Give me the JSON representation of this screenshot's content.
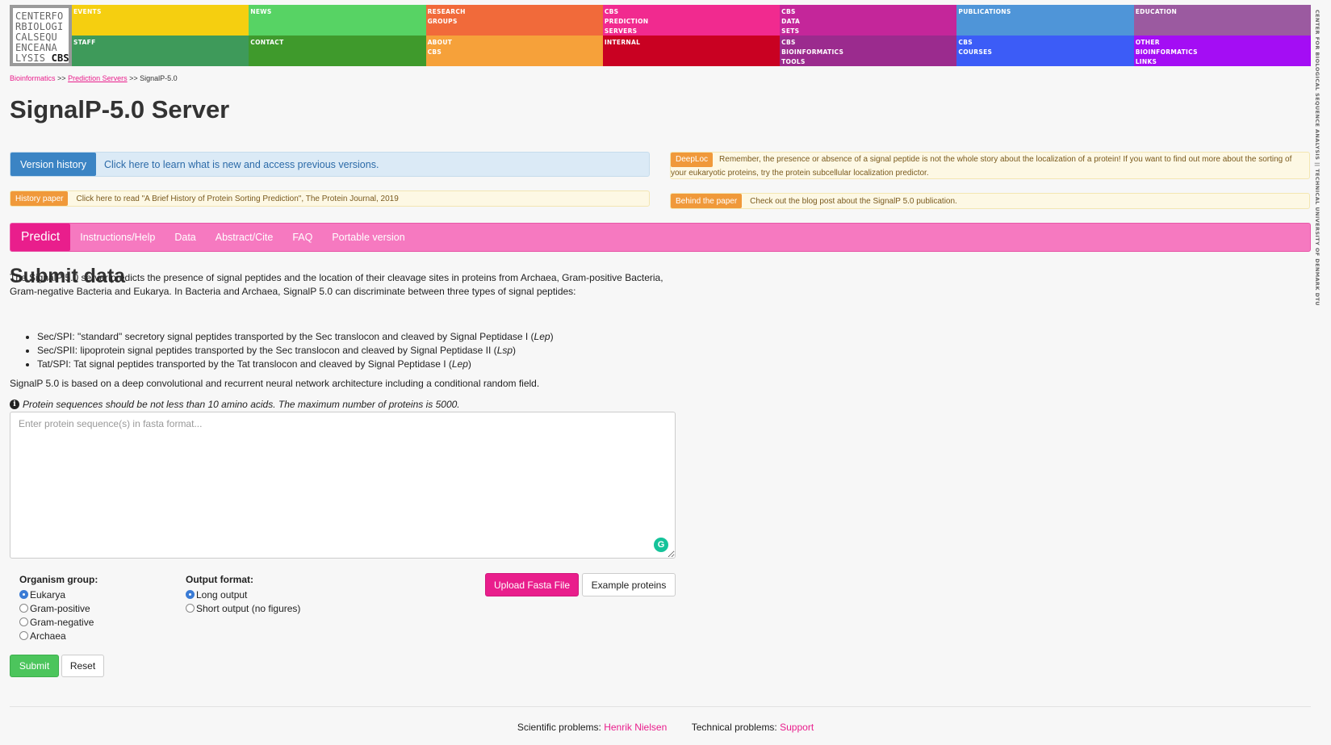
{
  "logo": {
    "lines": [
      "CENTERFO",
      "RBIOLOGI",
      "CALSEQU",
      "ENCEANA",
      "LYSIS"
    ],
    "brand": "CBS"
  },
  "nav": [
    {
      "label": "EVENTS",
      "color": "#f5cf10"
    },
    {
      "label": "NEWS",
      "color": "#57d364"
    },
    {
      "label": "RESEARCH\nGROUPS",
      "color": "#f16a3a"
    },
    {
      "label": "CBS\nPREDICTION\nSERVERS",
      "color": "#f12a8f"
    },
    {
      "label": "CBS\nDATA\nSETS",
      "color": "#c4269a"
    },
    {
      "label": "PUBLICATIONS",
      "color": "#4f95d8"
    },
    {
      "label": "EDUCATION",
      "color": "#9b5aa0"
    },
    {
      "label": "STAFF",
      "color": "#3e9a5a"
    },
    {
      "label": "CONTACT",
      "color": "#3f9a2c"
    },
    {
      "label": "ABOUT\nCBS",
      "color": "#f6a13a"
    },
    {
      "label": "INTERNAL",
      "color": "#c90122"
    },
    {
      "label": "CBS\nBIOINFORMATICS\nTOOLS",
      "color": "#9b2b8e"
    },
    {
      "label": "CBS\nCOURSES",
      "color": "#3c5cf7"
    },
    {
      "label": "OTHER\nBIOINFORMATICS\nLINKS",
      "color": "#a40df4"
    }
  ],
  "vertical_text": "CENTER FOR BIOLOGICAL SEQUENCE ANALYSIS  ||  TECHNICAL UNIVERSITY OF DENMARK DTU",
  "breadcrumb": {
    "item1": "Bioinformatics",
    "sep1": ">>",
    "item2": "Prediction Servers",
    "sep2": ">>",
    "current": "SignalP-5.0"
  },
  "page_title": "SignalP-5.0 Server",
  "version_history": {
    "button": "Version history",
    "text": "Click here to learn what is new and access previous versions."
  },
  "history_paper": {
    "badge": "History paper",
    "text": "Click here to read \"A Brief History of Protein Sorting Prediction\", The Protein Journal, 2019"
  },
  "deeploc": {
    "badge": "DeepLoc",
    "text": "Remember, the presence or absence of a signal peptide is not the whole story about the localization of a protein! If you want to find out more about the sorting of your eukaryotic proteins, try the protein subcellular localization predictor."
  },
  "behind_paper": {
    "badge": "Behind the paper",
    "text": "Check out the blog post about the SignalP 5.0 publication."
  },
  "tabs": [
    "Predict",
    "Instructions/Help",
    "Data",
    "Abstract/Cite",
    "FAQ",
    "Portable version"
  ],
  "submit_heading": "Submit data",
  "intro": "The SignalP 5.0 server predicts the presence of signal peptides and the location of their cleavage sites in proteins from Archaea, Gram-positive Bacteria, Gram-negative Bacteria and Eukarya. In Bacteria and Archaea, SignalP 5.0 can discriminate between three types of signal peptides:",
  "bullets": [
    {
      "text": "Sec/SPI: \"standard\" secretory signal peptides transported by the Sec translocon and cleaved by Signal Peptidase I (",
      "em": "Lep",
      "end": ")"
    },
    {
      "text": "Sec/SPII: lipoprotein signal peptides transported by the Sec translocon and cleaved by Signal Peptidase II (",
      "em": "Lsp",
      "end": ")"
    },
    {
      "text": "Tat/SPI: Tat signal peptides transported by the Tat translocon and cleaved by Signal Peptidase I (",
      "em": "Lep",
      "end": ")"
    }
  ],
  "architecture": "SignalP 5.0 is based on a deep convolutional and recurrent neural network architecture including a conditional random field.",
  "note": "Protein sequences should be not less than 10 amino acids. The maximum number of proteins is 5000.",
  "sequence_input": {
    "placeholder": "Enter protein sequence(s) in fasta format...",
    "value": ""
  },
  "organism_group": {
    "label": "Organism group:",
    "options": [
      "Eukarya",
      "Gram-positive",
      "Gram-negative",
      "Archaea"
    ],
    "selected": "Eukarya"
  },
  "output_format": {
    "label": "Output format:",
    "options": [
      "Long output",
      "Short output (no figures)"
    ],
    "selected": "Long output"
  },
  "buttons": {
    "upload": "Upload Fasta File",
    "example": "Example proteins",
    "submit": "Submit",
    "reset": "Reset"
  },
  "footer": {
    "sci_label": "Scientific problems:",
    "sci_contact": "Henrik Nielsen",
    "tech_label": "Technical problems:",
    "tech_contact": "Support"
  }
}
